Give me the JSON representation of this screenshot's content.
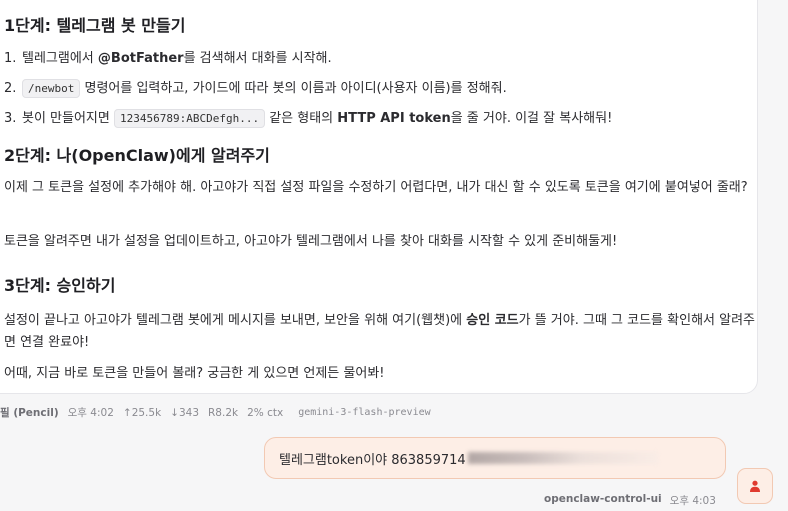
{
  "message": {
    "step1": {
      "heading": "1단계: 텔레그램 봇 만들기",
      "items": [
        {
          "num": "1.",
          "pre": "텔레그램에서 ",
          "bold": "@BotFather",
          "post": "를 검색해서 대화를 시작해."
        },
        {
          "num": "2.",
          "code": "/newbot",
          "post": " 명령어를 입력하고, 가이드에 따라 봇의 이름과 아이디(사용자 이름)를 정해줘."
        },
        {
          "num": "3.",
          "pre": "봇이 만들어지면 ",
          "code": "123456789:ABCDefgh...",
          "mid": " 같은 형태의 ",
          "bold": "HTTP API token",
          "post": "을 줄 거야. 이걸 잘 복사해둬!"
        }
      ]
    },
    "step2": {
      "heading": "2단계: 나(OpenClaw)에게 알려주기",
      "p1": "이제 그 토큰을 설정에 추가해야 해. 아고야가 직접 설정 파일을 수정하기 어렵다면, 내가 대신 할 수 있도록 토큰을 여기에 붙여넣어 줄래?",
      "p2": "토큰을 알려주면 내가 설정을 업데이트하고, 아고야가 텔레그램에서 나를 찾아 대화를 시작할 수 있게 준비해둘게!"
    },
    "step3": {
      "heading": "3단계: 승인하기",
      "p1_pre": "설정이 끝나고 아고야가 텔레그램 봇에게 메시지를 보내면, 보안을 위해 여기(웹챗)에 ",
      "p1_bold": "승인 코드",
      "p1_post": "가 뜰 거야. 그때 그 코드를 확인해서 알려주면 연결 완료야!",
      "p2": "어때, 지금 바로 토큰을 만들어 볼래? 궁금한 게 있으면 언제든 물어봐!"
    }
  },
  "meta": {
    "sender": "필 (Pencil)",
    "time": "오후 4:02",
    "tokens_up": "↑25.5k",
    "tokens_down": "↓343",
    "r": "R8.2k",
    "ctx": "2% ctx",
    "model": "gemini-3-flash-preview"
  },
  "user_message": {
    "text": "텔레그램token이야 863859714",
    "sender": "openclaw-control-ui",
    "time": "오후 4:03",
    "avatar_icon": "user-icon"
  },
  "colors": {
    "accent": "#e03a2f",
    "bubble_bg": "#fdeee6",
    "bubble_border": "#f2c9b3"
  }
}
